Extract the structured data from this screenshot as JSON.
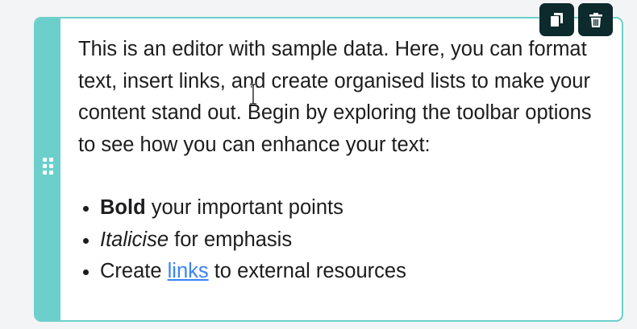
{
  "editor": {
    "paragraph": "This is an editor with sample data. Here, you can format text, insert links, and create organised lists to make your content stand out. Begin by exploring the toolbar options to see how you can enhance your text:",
    "list": [
      {
        "emphasis": "Bold",
        "rest": " your important points"
      },
      {
        "emphasis": "Italicise",
        "rest": " for emphasis"
      },
      {
        "before": "Create ",
        "link": "links",
        "after": " to external resources"
      }
    ]
  },
  "toolbar": {
    "copy_icon": "copy-icon",
    "delete_icon": "trash-icon"
  },
  "colors": {
    "accent": "#6ccfcb",
    "toolbar_bg": "#0d2a2c",
    "link": "#3b82f6",
    "text": "#1d1d1f"
  }
}
